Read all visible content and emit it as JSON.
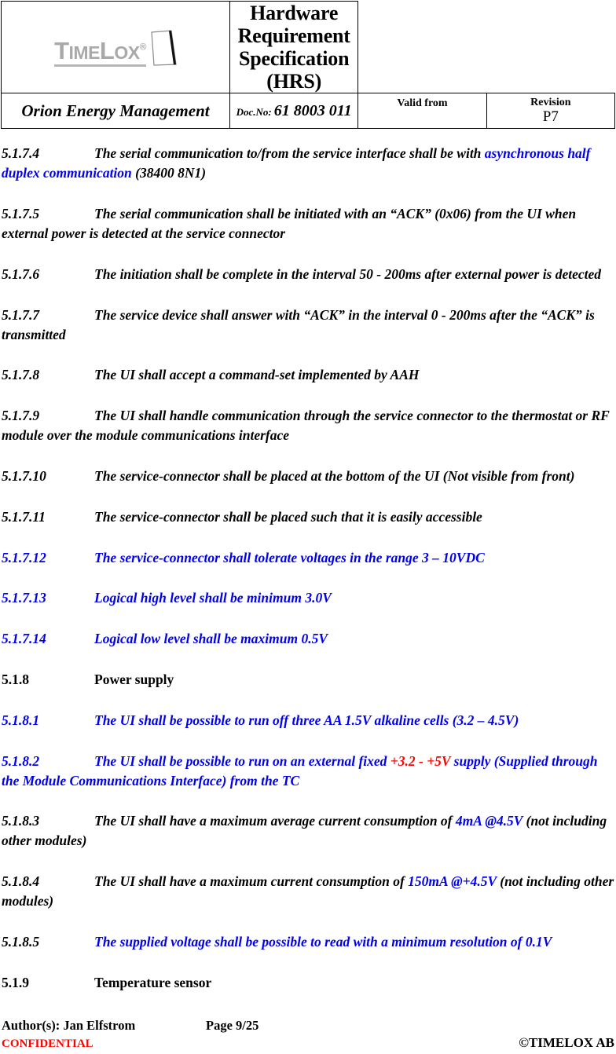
{
  "header": {
    "logo": {
      "icon_name": "timelox-logo",
      "word_part1": "T",
      "word_part2": "IME",
      "word_part3": "L",
      "word_part4": "OX",
      "registered": "®",
      "full_text": "TIMELOX®"
    },
    "document_title": "Hardware Requirement Specification (HRS)",
    "document_title_line1": "Hardware Requirement Specification",
    "document_title_line2": "(HRS)",
    "company": "Orion Energy Management",
    "docno_label": "Doc.No:",
    "docno_value": "61 8003 011",
    "valid_from_label": "Valid from",
    "valid_from_value": "",
    "revision_label": "Revision",
    "revision_value": "P7"
  },
  "colors": {
    "blue": "#0000EE",
    "red": "#FF0000",
    "black": "#000000",
    "logo_gray": "#A9A9A9"
  },
  "clauses": [
    {
      "id": "5.1.7.4",
      "num_color": "black",
      "type": "clause",
      "runs": [
        {
          "text": "The serial communication to/from the service interface shall be with ",
          "color": "black"
        },
        {
          "text": "asynchronous half duplex communication",
          "color": "blue"
        },
        {
          "text": " (38400 8N1)",
          "color": "black"
        }
      ]
    },
    {
      "id": "5.1.7.5",
      "num_color": "black",
      "type": "clause",
      "runs": [
        {
          "text": "The serial communication shall be initiated with an “ACK” (0x06) from the UI when external power is detected at the service connector",
          "color": "black"
        }
      ]
    },
    {
      "id": "5.1.7.6",
      "num_color": "black",
      "type": "clause",
      "runs": [
        {
          "text": "The initiation shall be complete in the interval 50 - 200ms after external power is detected",
          "color": "black"
        }
      ]
    },
    {
      "id": "5.1.7.7",
      "num_color": "black",
      "type": "clause",
      "runs": [
        {
          "text": "The service device shall answer with “ACK” in the interval 0 - 200ms after the “ACK” is transmitted",
          "color": "black"
        }
      ]
    },
    {
      "id": "5.1.7.8",
      "num_color": "black",
      "type": "clause",
      "runs": [
        {
          "text": "The UI shall accept a command-set implemented by AAH",
          "color": "black"
        }
      ]
    },
    {
      "id": "5.1.7.9",
      "num_color": "black",
      "type": "clause",
      "runs": [
        {
          "text": "The UI shall handle communication through the service connector to the thermostat or RF module over the module communications interface",
          "color": "black"
        }
      ]
    },
    {
      "id": "5.1.7.10",
      "num_color": "black",
      "type": "clause",
      "runs": [
        {
          "text": "The service-connector shall be placed at the bottom of the UI (Not visible from front)",
          "color": "black"
        }
      ]
    },
    {
      "id": "5.1.7.11",
      "num_color": "black",
      "type": "clause",
      "runs": [
        {
          "text": "The service-connector shall be placed such that it is easily accessible",
          "color": "black"
        }
      ]
    },
    {
      "id": "5.1.7.12",
      "num_color": "blue",
      "type": "clause",
      "runs": [
        {
          "text": "The service-connector shall tolerate voltages in the range 3 – 10VDC",
          "color": "blue"
        }
      ]
    },
    {
      "id": "5.1.7.13",
      "num_color": "blue",
      "type": "clause",
      "runs": [
        {
          "text": "Logical high level shall be minimum 3.0V",
          "color": "blue"
        }
      ]
    },
    {
      "id": "5.1.7.14",
      "num_color": "blue",
      "type": "clause",
      "runs": [
        {
          "text": "Logical low level shall be maximum 0.5V",
          "color": "blue"
        }
      ]
    },
    {
      "id": "5.1.8",
      "num_color": "black",
      "type": "heading",
      "runs": [
        {
          "text": "Power supply",
          "color": "black"
        }
      ]
    },
    {
      "id": "5.1.8.1",
      "num_color": "blue",
      "type": "clause",
      "runs": [
        {
          "text": "The UI shall be possible to run off three AA 1.5V alkaline cells (3.2 – 4.5V)",
          "color": "blue"
        }
      ]
    },
    {
      "id": "5.1.8.2",
      "num_color": "blue",
      "type": "clause",
      "runs": [
        {
          "text": "The UI shall be possible to run on an external fixed ",
          "color": "blue"
        },
        {
          "text": "+3.2 - +5V",
          "color": "red"
        },
        {
          "text": " supply (Supplied through the Module Communications Interface) from the TC",
          "color": "blue"
        }
      ]
    },
    {
      "id": "5.1.8.3",
      "num_color": "black",
      "type": "clause",
      "runs": [
        {
          "text": "The UI shall have a maximum average current consumption of ",
          "color": "black"
        },
        {
          "text": "4mA @4.5V",
          "color": "blue"
        },
        {
          "text": " (not including other modules)",
          "color": "black"
        }
      ]
    },
    {
      "id": "5.1.8.4",
      "num_color": "black",
      "type": "clause",
      "runs": [
        {
          "text": "The UI shall have a maximum current consumption of ",
          "color": "black"
        },
        {
          "text": "150mA @+4.5V",
          "color": "blue"
        },
        {
          "text": " (not including other modules)",
          "color": "black"
        }
      ]
    },
    {
      "id": "5.1.8.5",
      "num_color": "black",
      "type": "clause",
      "runs": [
        {
          "text": "The supplied voltage shall be possible to read with a minimum resolution of 0.1V",
          "color": "blue"
        }
      ]
    },
    {
      "id": "5.1.9",
      "num_color": "black",
      "type": "heading",
      "runs": [
        {
          "text": "Temperature sensor",
          "color": "black"
        }
      ]
    }
  ],
  "footer": {
    "author": "Author(s): Jan Elfstrom",
    "page": "Page 9/25",
    "confidential": "CONFIDENTIAL",
    "copyright": "©TIMELOX AB"
  }
}
